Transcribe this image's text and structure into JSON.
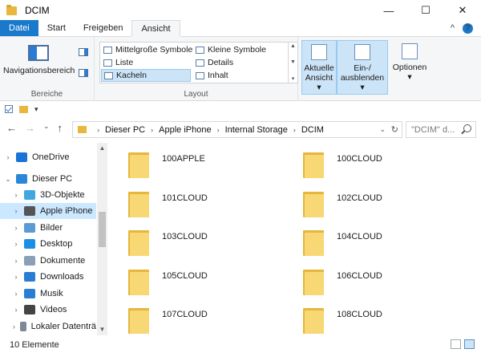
{
  "window": {
    "title": "DCIM",
    "minimize": "—",
    "maximize": "☐",
    "close": "✕"
  },
  "tabs": {
    "file": "Datei",
    "start": "Start",
    "share": "Freigeben",
    "view": "Ansicht",
    "collapse": "^",
    "help": "?"
  },
  "ribbon": {
    "pane_group": {
      "nav_button": "Navigationsbereich",
      "group_label": "Bereiche"
    },
    "layout_group": {
      "col1": [
        "Mittelgroße Symbole",
        "Liste",
        "Kacheln"
      ],
      "col2": [
        "Kleine Symbole",
        "Details",
        "Inhalt"
      ],
      "selected": "Kacheln",
      "group_label": "Layout"
    },
    "current_view": {
      "line1": "Aktuelle",
      "line2": "Ansicht"
    },
    "show_hide": {
      "line1": "Ein-/",
      "line2": "ausblenden"
    },
    "options": {
      "label": "Optionen"
    }
  },
  "address": {
    "crumbs": [
      "Dieser PC",
      "Apple iPhone",
      "Internal Storage",
      "DCIM"
    ],
    "search_placeholder": "\"DCIM\" d..."
  },
  "nav": {
    "items": [
      {
        "label": "OneDrive",
        "icon": "cloud-icon",
        "chev": "›",
        "color": "#1a73d6"
      },
      {
        "label": "Dieser PC",
        "icon": "computer-icon",
        "chev": "⌄",
        "color": "#2b87d6"
      },
      {
        "label": "3D-Objekte",
        "icon": "cube-icon",
        "chev": "›",
        "color": "#41a7e0"
      },
      {
        "label": "Apple iPhone",
        "icon": "phone-icon",
        "chev": "›",
        "color": "#555555"
      },
      {
        "label": "Bilder",
        "icon": "pictures-icon",
        "chev": "›",
        "color": "#5b9bd5"
      },
      {
        "label": "Desktop",
        "icon": "desktop-icon",
        "chev": "›",
        "color": "#1c8ee6"
      },
      {
        "label": "Dokumente",
        "icon": "documents-icon",
        "chev": "›",
        "color": "#8aa0b6"
      },
      {
        "label": "Downloads",
        "icon": "download-icon",
        "chev": "›",
        "color": "#2b7cd3"
      },
      {
        "label": "Musik",
        "icon": "music-icon",
        "chev": "›",
        "color": "#2b7cd3"
      },
      {
        "label": "Videos",
        "icon": "video-icon",
        "chev": "›",
        "color": "#444444"
      },
      {
        "label": "Lokaler Datenträ",
        "icon": "drive-icon",
        "chev": "›",
        "color": "#7d8a96"
      }
    ],
    "selected": "Apple iPhone"
  },
  "folders": [
    "100APPLE",
    "100CLOUD",
    "101CLOUD",
    "102CLOUD",
    "103CLOUD",
    "104CLOUD",
    "105CLOUD",
    "106CLOUD",
    "107CLOUD",
    "108CLOUD"
  ],
  "status": {
    "count": "10 Elemente"
  },
  "colors": {
    "accent": "#1979ca",
    "folder": "#f8d775",
    "selection": "#cce8ff"
  }
}
